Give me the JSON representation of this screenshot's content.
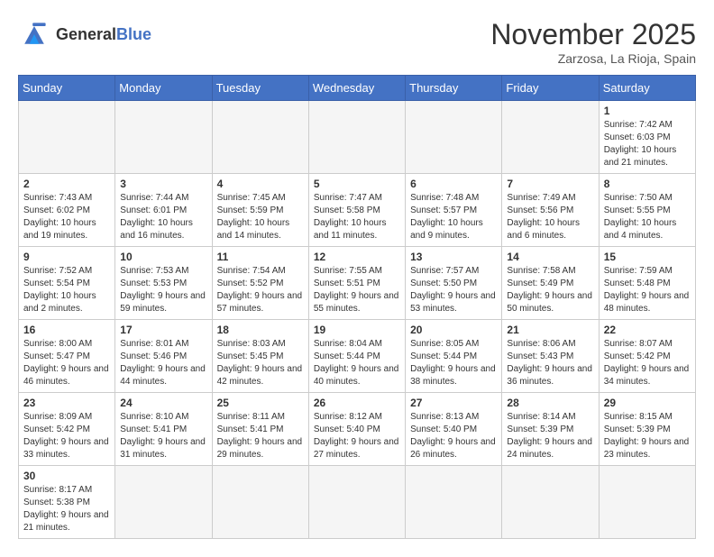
{
  "header": {
    "logo_general": "General",
    "logo_blue": "Blue",
    "month_title": "November 2025",
    "location": "Zarzosa, La Rioja, Spain"
  },
  "weekdays": [
    "Sunday",
    "Monday",
    "Tuesday",
    "Wednesday",
    "Thursday",
    "Friday",
    "Saturday"
  ],
  "days": {
    "1": {
      "sunrise": "7:42 AM",
      "sunset": "6:03 PM",
      "daylight": "10 hours and 21 minutes."
    },
    "2": {
      "sunrise": "7:43 AM",
      "sunset": "6:02 PM",
      "daylight": "10 hours and 19 minutes."
    },
    "3": {
      "sunrise": "7:44 AM",
      "sunset": "6:01 PM",
      "daylight": "10 hours and 16 minutes."
    },
    "4": {
      "sunrise": "7:45 AM",
      "sunset": "5:59 PM",
      "daylight": "10 hours and 14 minutes."
    },
    "5": {
      "sunrise": "7:47 AM",
      "sunset": "5:58 PM",
      "daylight": "10 hours and 11 minutes."
    },
    "6": {
      "sunrise": "7:48 AM",
      "sunset": "5:57 PM",
      "daylight": "10 hours and 9 minutes."
    },
    "7": {
      "sunrise": "7:49 AM",
      "sunset": "5:56 PM",
      "daylight": "10 hours and 6 minutes."
    },
    "8": {
      "sunrise": "7:50 AM",
      "sunset": "5:55 PM",
      "daylight": "10 hours and 4 minutes."
    },
    "9": {
      "sunrise": "7:52 AM",
      "sunset": "5:54 PM",
      "daylight": "10 hours and 2 minutes."
    },
    "10": {
      "sunrise": "7:53 AM",
      "sunset": "5:53 PM",
      "daylight": "9 hours and 59 minutes."
    },
    "11": {
      "sunrise": "7:54 AM",
      "sunset": "5:52 PM",
      "daylight": "9 hours and 57 minutes."
    },
    "12": {
      "sunrise": "7:55 AM",
      "sunset": "5:51 PM",
      "daylight": "9 hours and 55 minutes."
    },
    "13": {
      "sunrise": "7:57 AM",
      "sunset": "5:50 PM",
      "daylight": "9 hours and 53 minutes."
    },
    "14": {
      "sunrise": "7:58 AM",
      "sunset": "5:49 PM",
      "daylight": "9 hours and 50 minutes."
    },
    "15": {
      "sunrise": "7:59 AM",
      "sunset": "5:48 PM",
      "daylight": "9 hours and 48 minutes."
    },
    "16": {
      "sunrise": "8:00 AM",
      "sunset": "5:47 PM",
      "daylight": "9 hours and 46 minutes."
    },
    "17": {
      "sunrise": "8:01 AM",
      "sunset": "5:46 PM",
      "daylight": "9 hours and 44 minutes."
    },
    "18": {
      "sunrise": "8:03 AM",
      "sunset": "5:45 PM",
      "daylight": "9 hours and 42 minutes."
    },
    "19": {
      "sunrise": "8:04 AM",
      "sunset": "5:44 PM",
      "daylight": "9 hours and 40 minutes."
    },
    "20": {
      "sunrise": "8:05 AM",
      "sunset": "5:44 PM",
      "daylight": "9 hours and 38 minutes."
    },
    "21": {
      "sunrise": "8:06 AM",
      "sunset": "5:43 PM",
      "daylight": "9 hours and 36 minutes."
    },
    "22": {
      "sunrise": "8:07 AM",
      "sunset": "5:42 PM",
      "daylight": "9 hours and 34 minutes."
    },
    "23": {
      "sunrise": "8:09 AM",
      "sunset": "5:42 PM",
      "daylight": "9 hours and 33 minutes."
    },
    "24": {
      "sunrise": "8:10 AM",
      "sunset": "5:41 PM",
      "daylight": "9 hours and 31 minutes."
    },
    "25": {
      "sunrise": "8:11 AM",
      "sunset": "5:41 PM",
      "daylight": "9 hours and 29 minutes."
    },
    "26": {
      "sunrise": "8:12 AM",
      "sunset": "5:40 PM",
      "daylight": "9 hours and 27 minutes."
    },
    "27": {
      "sunrise": "8:13 AM",
      "sunset": "5:40 PM",
      "daylight": "9 hours and 26 minutes."
    },
    "28": {
      "sunrise": "8:14 AM",
      "sunset": "5:39 PM",
      "daylight": "9 hours and 24 minutes."
    },
    "29": {
      "sunrise": "8:15 AM",
      "sunset": "5:39 PM",
      "daylight": "9 hours and 23 minutes."
    },
    "30": {
      "sunrise": "8:17 AM",
      "sunset": "5:38 PM",
      "daylight": "9 hours and 21 minutes."
    }
  }
}
